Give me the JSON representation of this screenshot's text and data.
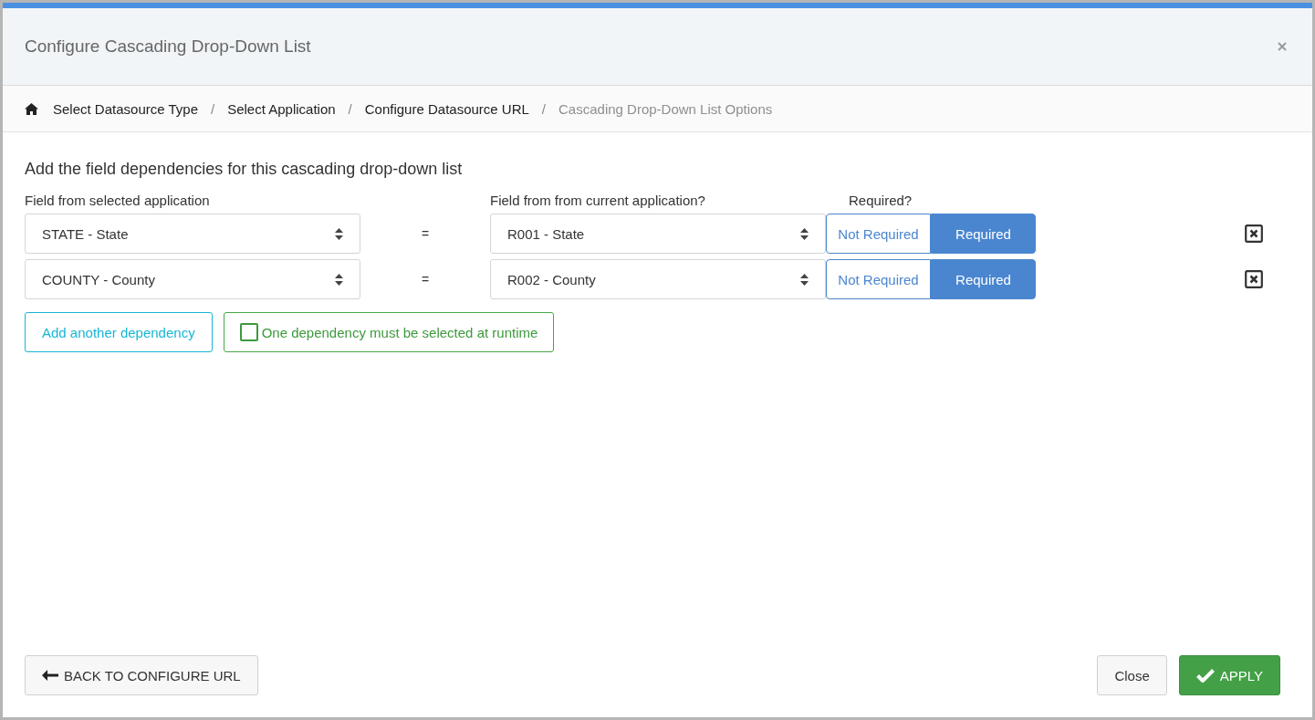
{
  "dialog": {
    "title": "Configure Cascading Drop-Down List"
  },
  "breadcrumb": [
    {
      "label": "Select Datasource Type",
      "current": false
    },
    {
      "label": "Select Application",
      "current": false
    },
    {
      "label": "Configure Datasource URL",
      "current": false
    },
    {
      "label": "Cascading Drop-Down List Options",
      "current": true
    }
  ],
  "breadcrumb_separator": "/",
  "heading": "Add the field dependencies for this cascading drop-down list",
  "columns": [
    "Field from selected application",
    "Field from from current application?",
    "Required?"
  ],
  "dependencies": [
    {
      "source_field": "STATE - State",
      "equals": "=",
      "target_field": "R001 - State",
      "options": [
        {
          "label": "Not Required",
          "selected": false
        },
        {
          "label": "Required",
          "selected": true
        }
      ]
    },
    {
      "source_field": "COUNTY - County",
      "equals": "=",
      "target_field": "R002 - County",
      "options": [
        {
          "label": "Not Required",
          "selected": false
        },
        {
          "label": "Required",
          "selected": true
        }
      ]
    }
  ],
  "add_button": "Add another dependency",
  "runtime_option": {
    "label": "One dependency must be selected at runtime",
    "checked": false
  },
  "footer": {
    "back_button": "BACK TO CONFIGURE URL",
    "close_button": "Close",
    "apply_button": "APPLY"
  }
}
